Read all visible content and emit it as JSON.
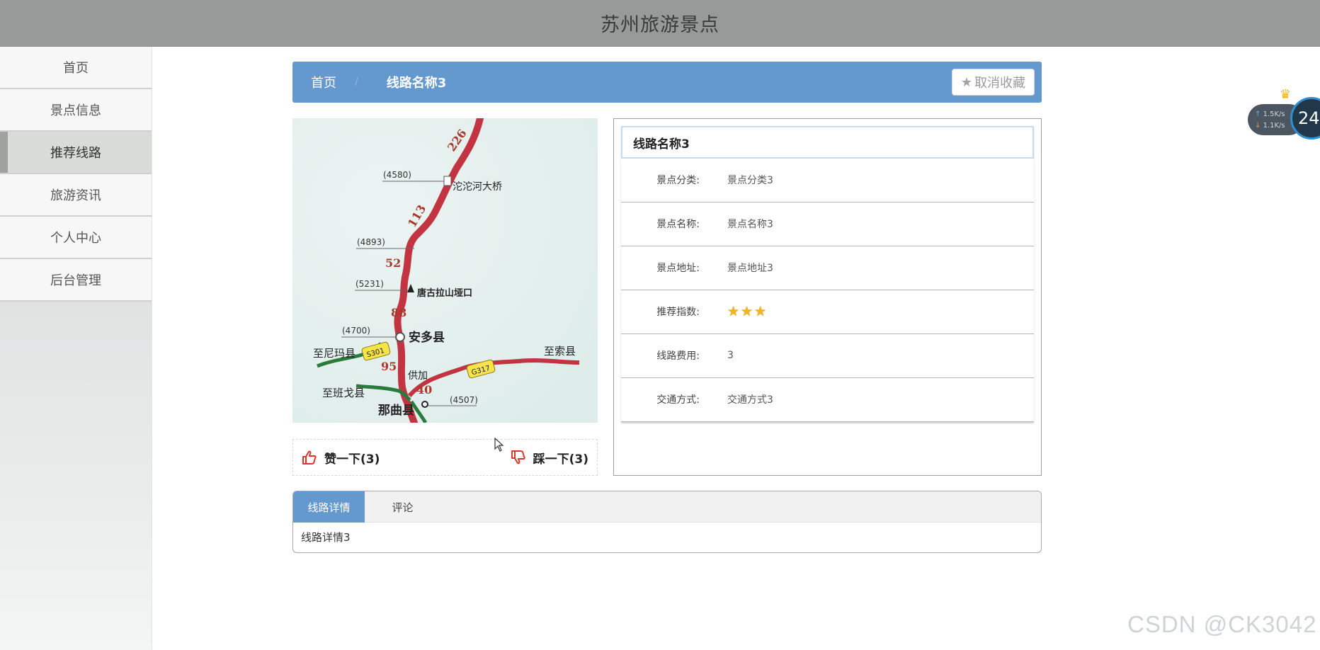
{
  "header": {
    "title": "苏州旅游景点"
  },
  "sidebar": {
    "items": [
      {
        "label": "首页"
      },
      {
        "label": "景点信息"
      },
      {
        "label": "推荐线路"
      },
      {
        "label": "旅游资讯"
      },
      {
        "label": "个人中心"
      },
      {
        "label": "后台管理"
      }
    ],
    "active_index": 2
  },
  "breadcrumb": {
    "home_label": "首页",
    "separator": "/",
    "current_label": "线路名称3",
    "favorite_label": "取消收藏",
    "favorite_icon": "star-icon"
  },
  "map_image": {
    "labels": [
      "226",
      "(4580)",
      "沱沱河大桥",
      "113",
      "(4893)",
      "52",
      "(5231)",
      "唐古拉山垭口",
      "88",
      "(4700)",
      "安多县",
      "至尼玛县",
      "S301",
      "95",
      "供加",
      "G317",
      "至索县",
      "至班戈县",
      "40",
      "(4507)",
      "那曲县"
    ]
  },
  "votes": {
    "up_label": "赞一下(3)",
    "down_label": "踩一下(3)",
    "up_icon": "thumbs-up-icon",
    "down_icon": "thumbs-down-icon"
  },
  "info": {
    "title": "线路名称3",
    "rows": [
      {
        "label": "景点分类:",
        "value": "景点分类3"
      },
      {
        "label": "景点名称:",
        "value": "景点名称3"
      },
      {
        "label": "景点地址:",
        "value": "景点地址3"
      },
      {
        "label": "推荐指数:",
        "value": "",
        "stars": 3
      },
      {
        "label": "线路费用:",
        "value": "3"
      },
      {
        "label": "交通方式:",
        "value": "交通方式3"
      }
    ]
  },
  "tabs": {
    "items": [
      {
        "label": "线路详情"
      },
      {
        "label": "评论"
      }
    ],
    "active_index": 0,
    "content": "线路详情3"
  },
  "net_widget": {
    "upload": "1.5K/s",
    "download": "1.1K/s",
    "number": "24"
  },
  "watermark": "CSDN @CK3042",
  "colors": {
    "accent": "#6499cf",
    "topbar": "#989a99",
    "star": "#f2b51b",
    "vote_icon": "#e0342a"
  }
}
